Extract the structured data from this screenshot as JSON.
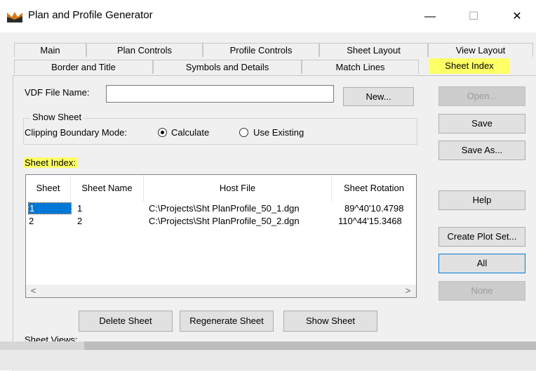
{
  "window": {
    "title": "Plan and Profile Generator",
    "minimize_glyph": "—",
    "maximize_glyph": "☐",
    "close_glyph": "✕"
  },
  "tabs_row1": [
    {
      "label": "Main"
    },
    {
      "label": "Plan Controls"
    },
    {
      "label": "Profile Controls"
    },
    {
      "label": "Sheet Layout"
    },
    {
      "label": "View Layout"
    }
  ],
  "tabs_row2": [
    {
      "label": "Border and Title"
    },
    {
      "label": "Symbols and Details"
    },
    {
      "label": "Match Lines"
    },
    {
      "label": "Sheet Index",
      "active": true
    }
  ],
  "vdf": {
    "label": "VDF File Name:",
    "value": "",
    "new_button": "New..."
  },
  "show_sheet": {
    "group_title": "Show Sheet",
    "clip_label": "Clipping Boundary Mode:",
    "options": [
      "Calculate",
      "Use Existing"
    ],
    "selected": "Calculate"
  },
  "sheet_index": {
    "label": "Sheet Index:",
    "columns": [
      "Sheet",
      "Sheet Name",
      "Host File",
      "Sheet Rotation"
    ],
    "rows": [
      {
        "sheet": "1",
        "name": "1",
        "host": "C:\\Projects\\Sht PlanProfile_50_1.dgn",
        "rotation": "89^40'10.4798"
      },
      {
        "sheet": "2",
        "name": "2",
        "host": "C:\\Projects\\Sht PlanProfile_50_2.dgn",
        "rotation": "110^44'15.3468"
      }
    ],
    "scroll_left": "<",
    "scroll_right": ">"
  },
  "bottom_buttons": {
    "delete": "Delete Sheet",
    "regenerate": "Regenerate Sheet",
    "show": "Show Sheet"
  },
  "sheet_views_label": "Sheet Views:",
  "right_buttons": {
    "open": "Open...",
    "save": "Save",
    "save_as": "Save As...",
    "help": "Help",
    "create_plot_set": "Create Plot Set...",
    "all": "All",
    "none": "None"
  },
  "colors": {
    "highlight": "#ffff66",
    "selection": "#0078d7",
    "dialog_bg": "#f0f0f0"
  }
}
